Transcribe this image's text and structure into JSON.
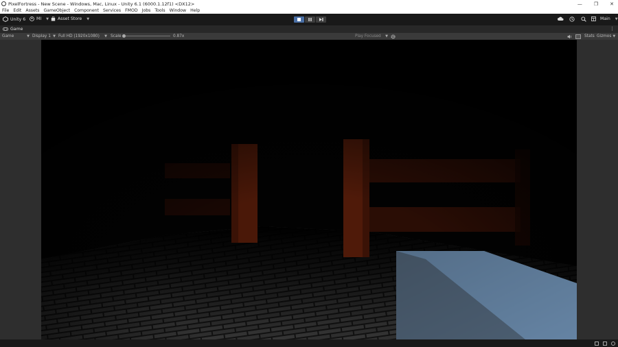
{
  "window": {
    "title": "PixelFortress - New Scene - Windows, Mac, Linux - Unity 6.1 (6000.1.12f1) <DX12>",
    "minimize": "—",
    "maximize": "❐",
    "close": "✕"
  },
  "menu": [
    "File",
    "Edit",
    "Assets",
    "GameObject",
    "Component",
    "Services",
    "FMOD",
    "Jobs",
    "Tools",
    "Window",
    "Help"
  ],
  "toolbar": {
    "unity_label": "Unity 6",
    "account_label": "MI",
    "asset_store_label": "Asset Store",
    "layout_label": "Main"
  },
  "tab": {
    "label": "Game"
  },
  "game_toolbar": {
    "view_mode": "Game",
    "display": "Display 1",
    "resolution": "Full HD (1920x1080)",
    "scale_label": "Scale",
    "scale_value": "0.87x",
    "play_mode": "Play Focused",
    "stats_label": "Stats",
    "gizmos_label": "Gizmos"
  },
  "colors": {
    "accent": "#4a6fa5",
    "post_color": "#5a1f0c",
    "floor_tile": "#3a3a3a",
    "block_color": "#5d7a98"
  }
}
